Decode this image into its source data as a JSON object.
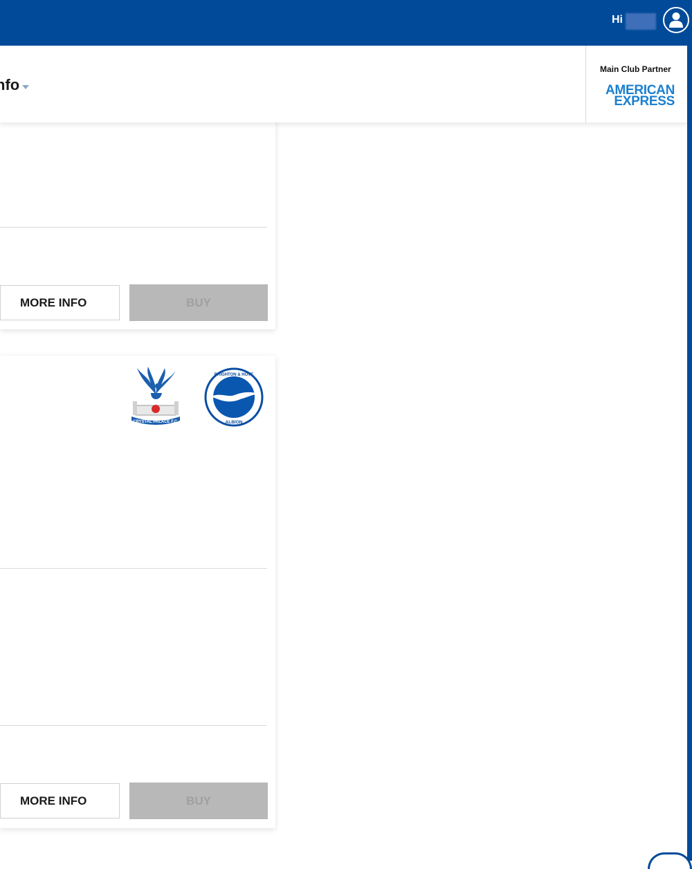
{
  "header": {
    "greeting": "Hi",
    "user_name_hidden": true
  },
  "subheader": {
    "title": "nfo",
    "partner_label": "Main Club Partner",
    "partner_logo_line1": "AMERICAN",
    "partner_logo_line2": "EXPRESS"
  },
  "cards": [
    {
      "more_info_label": "MORE INFO",
      "buy_label": "BUY",
      "buy_enabled": false
    },
    {
      "home_crest": "crystal-palace-crest",
      "home_crest_text": "CRYSTAL PALACE F.C.",
      "away_crest": "brighton-crest",
      "away_crest_text_top": "BRIGHTON & HOVE",
      "away_crest_text_bottom": "ALBION",
      "more_info_label": "MORE INFO",
      "buy_label": "BUY",
      "buy_enabled": false
    }
  ],
  "colors": {
    "brand_blue": "#004a99",
    "amex_blue": "#1a7fd0",
    "disabled_button": "#b8b8b8"
  }
}
